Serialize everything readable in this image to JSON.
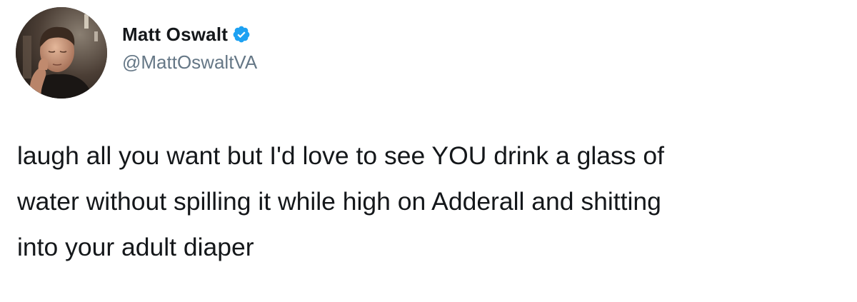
{
  "tweet": {
    "author": {
      "display_name": "Matt Oswalt",
      "handle": "@MattOswaltVA",
      "verified_icon": "verified-badge-icon",
      "avatar_icon": "profile-photo"
    },
    "text_lines": [
      "laugh all you want but I'd love to see YOU drink a glass of",
      "water without spilling it while high on Adderall and shitting",
      "into your adult diaper"
    ]
  },
  "colors": {
    "text": "#14171a",
    "handle": "#657786",
    "verified": "#1da1f2",
    "background": "#ffffff"
  }
}
